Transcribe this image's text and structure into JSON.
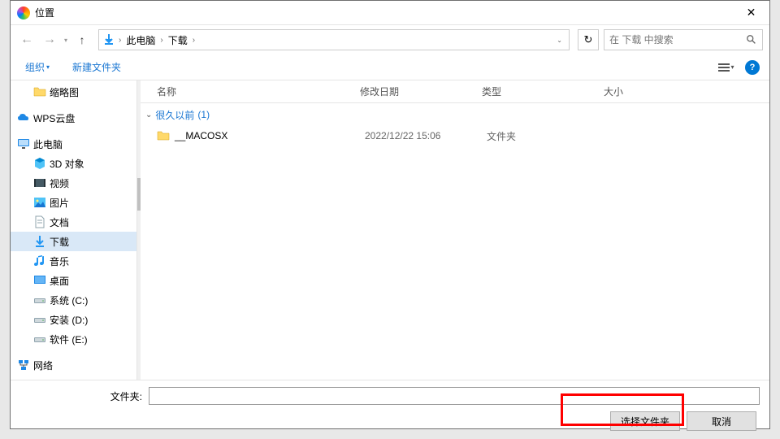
{
  "window": {
    "title": "位置"
  },
  "nav": {
    "breadcrumb": [
      "此电脑",
      "下载"
    ],
    "search_placeholder": "在 下载 中搜索"
  },
  "toolbar": {
    "organize": "组织",
    "new_folder": "新建文件夹"
  },
  "sidebar": {
    "items": [
      {
        "label": "缩略图",
        "icon": "folder",
        "indent": true
      },
      {
        "label": "WPS云盘",
        "icon": "cloud",
        "indent": false
      },
      {
        "label": "此电脑",
        "icon": "monitor",
        "indent": false
      },
      {
        "label": "3D 对象",
        "icon": "cube",
        "indent": true
      },
      {
        "label": "视频",
        "icon": "video",
        "indent": true
      },
      {
        "label": "图片",
        "icon": "picture",
        "indent": true
      },
      {
        "label": "文档",
        "icon": "doc",
        "indent": true
      },
      {
        "label": "下载",
        "icon": "download",
        "indent": true,
        "selected": true
      },
      {
        "label": "音乐",
        "icon": "music",
        "indent": true
      },
      {
        "label": "桌面",
        "icon": "desktop",
        "indent": true
      },
      {
        "label": "系统 (C:)",
        "icon": "drive",
        "indent": true
      },
      {
        "label": "安装 (D:)",
        "icon": "drive",
        "indent": true
      },
      {
        "label": "软件 (E:)",
        "icon": "drive",
        "indent": true
      },
      {
        "label": "网络",
        "icon": "network",
        "indent": false
      }
    ]
  },
  "columns": {
    "name": "名称",
    "date": "修改日期",
    "type": "类型",
    "size": "大小"
  },
  "group": {
    "label": "很久以前",
    "count": "(1)"
  },
  "files": [
    {
      "name": "__MACOSX",
      "date": "2022/12/22 15:06",
      "type": "文件夹"
    }
  ],
  "footer": {
    "folder_label": "文件夹:",
    "select_button": "选择文件夹",
    "cancel_button": "取消"
  }
}
